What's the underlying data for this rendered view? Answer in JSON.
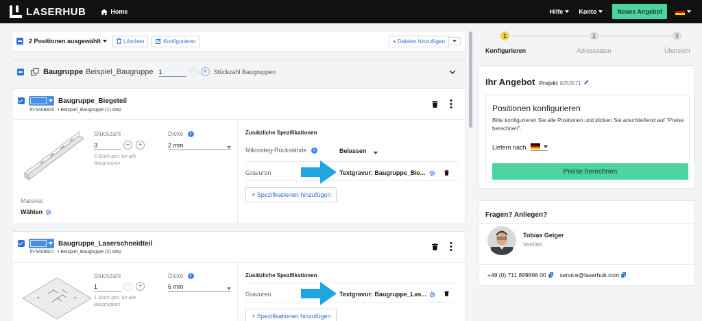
{
  "topbar": {
    "brand": "LASERHUB",
    "home": "Home",
    "help": "Hilfe",
    "account": "Konto",
    "new_offer": "Neues Angebot"
  },
  "toolbar": {
    "selected": "2 Positionen ausgewählt",
    "delete": "Löschen",
    "configure": "Konfigurieren",
    "add_files": "+ Dateien hinzufügen"
  },
  "assembly": {
    "label": "Baugruppe",
    "name": "Beispiel_Baugruppe",
    "qty": "1",
    "qty_label": "Stückzahl Baugruppen"
  },
  "parts": [
    {
      "title": "Baugruppe_Biegeteil",
      "id": "lh-5408826",
      "file": "• Beispiel_Baugruppe (1).step",
      "qty_label": "Stückzahl",
      "qty": "3",
      "qty_note": "3 Stück ges. für alle Baugruppen",
      "thickness_label": "Dicke",
      "thickness": "2 mm",
      "material_label": "Material",
      "material_value": "Wählen",
      "spec_title": "Zusätzliche Spezifikationen",
      "micro_label": "Mikrosteg-Rückstände",
      "micro_value": "Belassen",
      "engrave_label": "Gravuren",
      "engrave_value": "Textgravur: Baugruppe_Bie...",
      "add_spec": "+ Spezifikationen hinzufügen"
    },
    {
      "title": "Baugruppe_Laserschneidteil",
      "id": "lh-5408827",
      "file": "• Beispiel_Baugruppe (2).step",
      "qty_label": "Stückzahl",
      "qty": "1",
      "qty_note": "1 Stück ges. für alle Baugruppen",
      "thickness_label": "Dicke",
      "thickness": "6 mm",
      "spec_title": "Zusätzliche Spezifikationen",
      "engrave_label": "Gravuren",
      "engrave_value": "Textgravur: Baugruppe_Las...",
      "add_spec": "+ Spezifikationen hinzufügen"
    }
  ],
  "steps": [
    {
      "num": "1",
      "label": "Konfigurieren"
    },
    {
      "num": "2",
      "label": "Adressdaten"
    },
    {
      "num": "3",
      "label": "Übersicht"
    }
  ],
  "offer": {
    "title": "Ihr Angebot",
    "project_label": "Projekt",
    "project_no": "8253571",
    "box_title": "Positionen konfigurieren",
    "box_text": "Bitte konfigurieren Sie alle Positionen und klicken Sie anschließend auf \"Preise berechnen\".",
    "deliver": "Liefern nach",
    "calc": "Preise berechnen"
  },
  "contact": {
    "title": "Fragen? Anliegen?",
    "name": "Tobias Geiger",
    "role": "Vertrieb",
    "phone": "+49 (0) 711 899898 00",
    "email": "service@laserhub.com"
  },
  "colors": {
    "accent": "#2f6fd6",
    "green": "#4cd3a0",
    "arrow": "#1fa5e0"
  }
}
